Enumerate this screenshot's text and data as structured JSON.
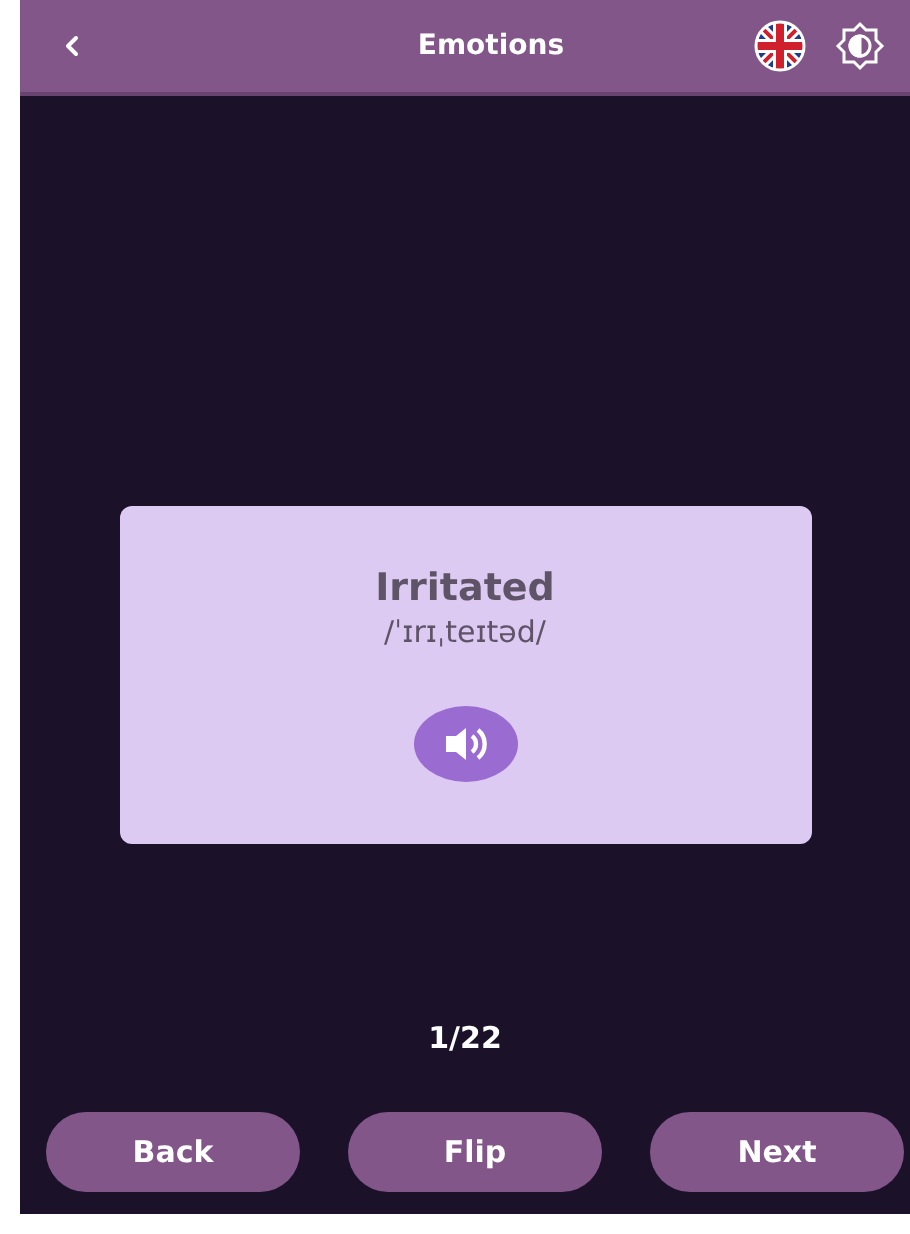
{
  "header": {
    "title": "Emotions"
  },
  "card": {
    "word": "Irritated",
    "phonetic": "/ˈɪrɪˌteɪtəd/"
  },
  "counter": "1/22",
  "buttons": [
    {
      "label": "Back"
    },
    {
      "label": "Flip"
    },
    {
      "label": "Next"
    }
  ]
}
